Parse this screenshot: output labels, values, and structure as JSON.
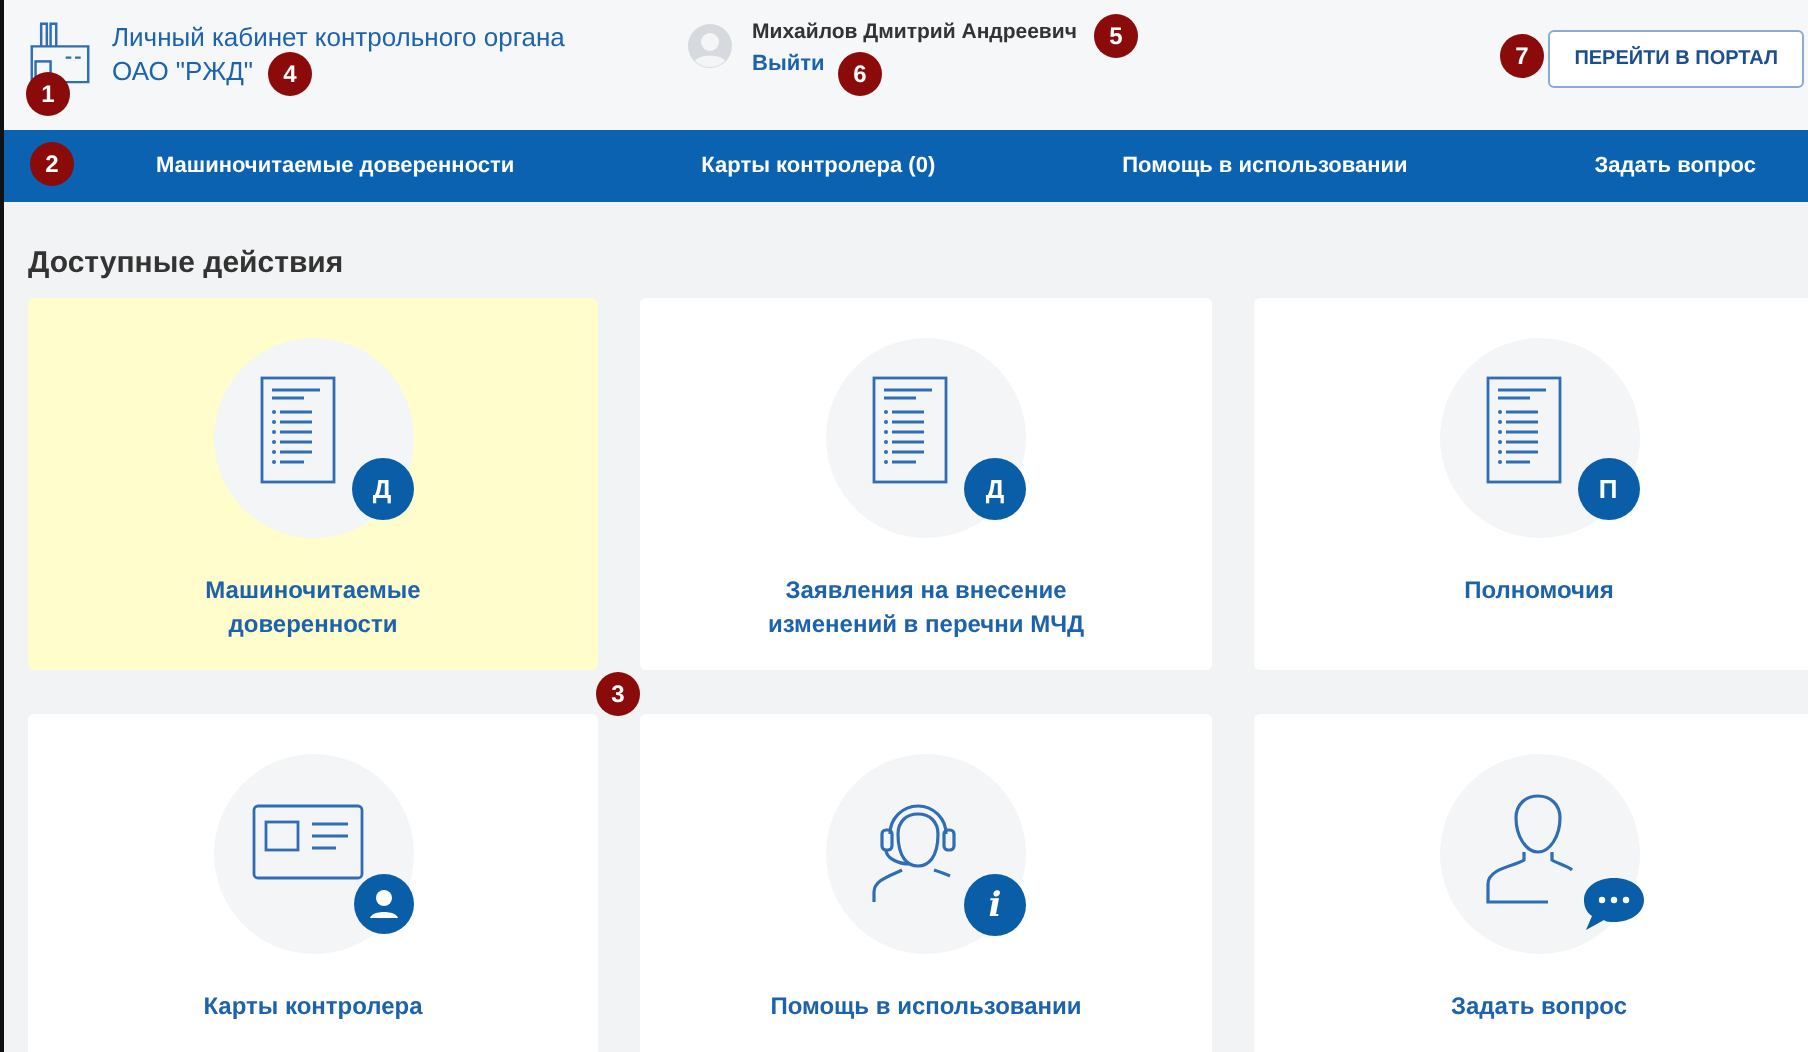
{
  "header": {
    "title_line1": "Личный кабинет контрольного органа",
    "title_line2": "ОАО \"РЖД\"",
    "user_name": "Михайлов Дмитрий Андреевич",
    "logout": "Выйти",
    "portal_button": "ПЕРЕЙТИ В ПОРТАЛ"
  },
  "nav": [
    {
      "label": "Машиночитаемые доверенности"
    },
    {
      "label": "Карты контролера (0)"
    },
    {
      "label": "Помощь в использовании"
    },
    {
      "label": "Задать вопрос"
    }
  ],
  "section_title": "Доступные действия",
  "cards": [
    {
      "kind": "document",
      "badge": "Д",
      "title": "Машиночитаемые доверенности",
      "highlighted": true
    },
    {
      "kind": "document",
      "badge": "Д",
      "title": "Заявления на внесение изменений в перечни МЧД",
      "highlighted": false
    },
    {
      "kind": "document",
      "badge": "П",
      "title": "Полномочия",
      "highlighted": false
    },
    {
      "kind": "card",
      "title": "Карты контролера",
      "highlighted": false
    },
    {
      "kind": "support",
      "badge": "i",
      "title": "Помощь в использовании",
      "highlighted": false
    },
    {
      "kind": "question",
      "title": "Задать вопрос",
      "highlighted": false
    }
  ],
  "callouts": [
    "1",
    "2",
    "3",
    "4",
    "5",
    "6",
    "7"
  ]
}
